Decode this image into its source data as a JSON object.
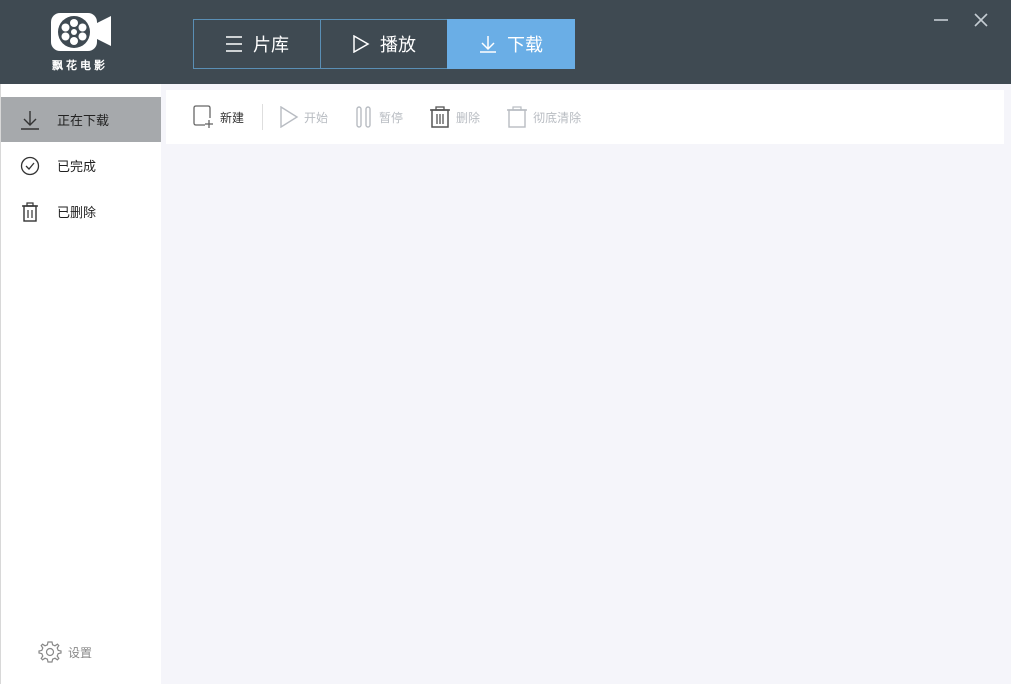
{
  "app": {
    "logo_text": "飘花电影"
  },
  "header": {
    "tabs": [
      {
        "label": "片库",
        "icon": "menu-icon"
      },
      {
        "label": "播放",
        "icon": "play-icon"
      },
      {
        "label": "下载",
        "icon": "download-icon",
        "active": true
      }
    ],
    "window_controls": [
      "minimize-icon",
      "close-icon"
    ]
  },
  "sidebar": {
    "items": [
      {
        "label": "正在下载",
        "icon": "download-icon",
        "active": true
      },
      {
        "label": "已完成",
        "icon": "check-circle-icon"
      },
      {
        "label": "已删除",
        "icon": "trash-icon"
      }
    ],
    "settings_label": "设置"
  },
  "toolbar": {
    "new_label": "新建",
    "start_label": "开始",
    "pause_label": "暂停",
    "delete_label": "删除",
    "purge_label": "彻底清除"
  },
  "colors": {
    "titlebar": "#3f4a52",
    "active_tab": "#6aaee6",
    "active_sidebar": "#a6a9ac",
    "main_bg": "#f5f5fa"
  }
}
